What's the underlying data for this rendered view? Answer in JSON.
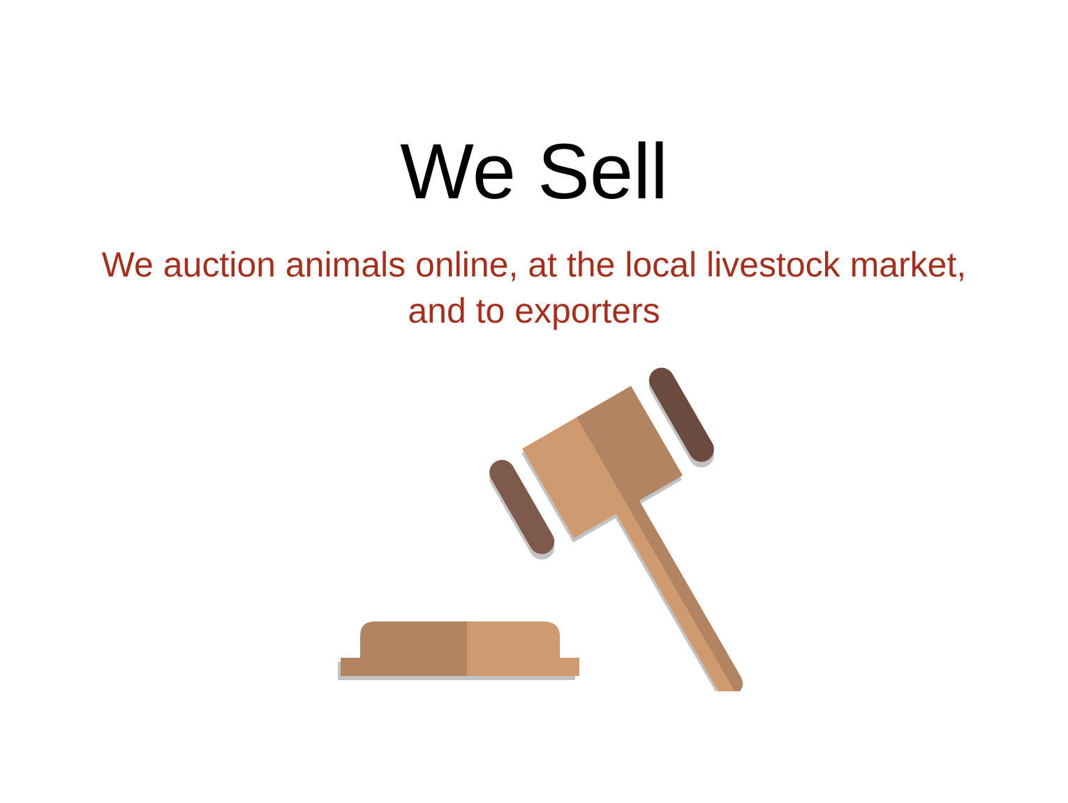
{
  "slide": {
    "title": "We Sell",
    "subtitle": "We auction animals online, at the local livestock market, and to exporters"
  },
  "illustration": {
    "icon": "gavel-icon",
    "colors": {
      "wood_light": "#D09A71",
      "wood_dark": "#B28461",
      "band_light": "#7E5A4C",
      "band_dark": "#6B4B3F",
      "shadow": "#C3C3C3"
    }
  },
  "colors": {
    "title": "#000000",
    "subtitle": "#A3301F",
    "background": "#FFFFFF"
  }
}
